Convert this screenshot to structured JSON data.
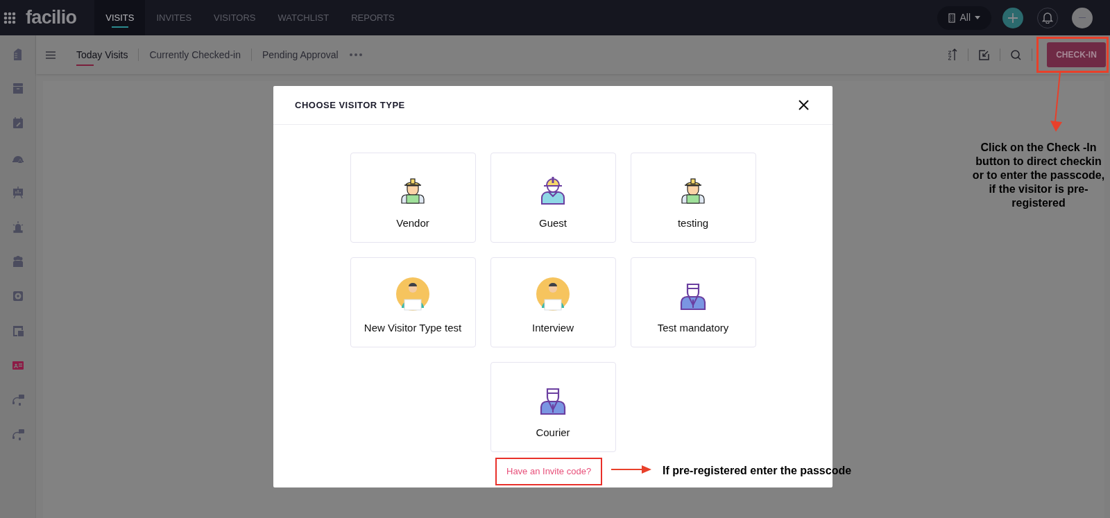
{
  "app": {
    "logo": "facilio"
  },
  "top_nav": [
    {
      "label": "VISITS",
      "selected": true
    },
    {
      "label": "INVITES",
      "selected": false
    },
    {
      "label": "VISITORS",
      "selected": false
    },
    {
      "label": "WATCHLIST",
      "selected": false
    },
    {
      "label": "REPORTS",
      "selected": false
    }
  ],
  "site_filter": {
    "label": "All"
  },
  "sidebar": {
    "items": [
      {
        "kind": "building",
        "selected": false
      },
      {
        "kind": "archive",
        "selected": false
      },
      {
        "kind": "calendar",
        "selected": false
      },
      {
        "kind": "helmet",
        "selected": false
      },
      {
        "kind": "board",
        "selected": false
      },
      {
        "kind": "alarm",
        "selected": false
      },
      {
        "kind": "people",
        "selected": false
      },
      {
        "kind": "unit",
        "selected": false
      },
      {
        "kind": "window",
        "selected": false
      },
      {
        "kind": "card",
        "selected": true
      },
      {
        "kind": "headset",
        "selected": false
      },
      {
        "kind": "headset",
        "selected": false
      }
    ]
  },
  "view_tabs": [
    {
      "label": "Today Visits",
      "selected": true
    },
    {
      "label": "Currently Checked-in",
      "selected": false
    },
    {
      "label": "Pending Approval",
      "selected": false
    }
  ],
  "check_in_button": {
    "label": "CHECK-IN"
  },
  "modal": {
    "title": "CHOOSE VISITOR TYPE",
    "visitor_types": [
      {
        "label": "Vendor",
        "kind": "worker"
      },
      {
        "label": "Guest",
        "kind": "guest"
      },
      {
        "label": "testing",
        "kind": "worker"
      },
      {
        "label": "New Visitor Type test",
        "kind": "laptop"
      },
      {
        "label": "Interview",
        "kind": "laptop"
      },
      {
        "label": "Test mandatory",
        "kind": "tie"
      },
      {
        "label": "Courier",
        "kind": "tie"
      }
    ],
    "invite_link": "Have an Invite code?"
  },
  "annotations": [
    {
      "text": "Click on the Check -In button to direct checkin or to enter the passcode, if the visitor is pre-registered"
    },
    {
      "text": "If pre-registered enter the passcode"
    }
  ]
}
